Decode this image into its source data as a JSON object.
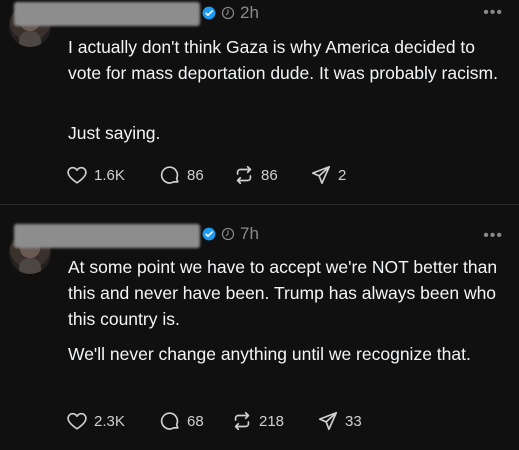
{
  "posts": [
    {
      "time": "2h",
      "paragraphs": [
        "I actually don't think Gaza is why America decided to vote for mass deportation dude. It was probably racism.",
        "Just saying."
      ],
      "likes": "1.6K",
      "replies": "86",
      "reposts": "86",
      "shares": "2",
      "more_label": "•••"
    },
    {
      "time": "7h",
      "paragraphs": [
        "At some point we have to accept we're NOT better than this and never have been. Trump has always been who this country is.",
        "We'll never change anything until we recognize that."
      ],
      "likes": "2.3K",
      "replies": "68",
      "reposts": "218",
      "shares": "33",
      "more_label": "•••"
    }
  ],
  "colors": {
    "background": "#101010",
    "text": "#f3f5f7",
    "muted": "#8a8a8a",
    "verified": "#1d9bf0"
  },
  "icons": [
    "heart-icon",
    "comment-icon",
    "repost-icon",
    "share-icon",
    "verified-icon",
    "timer-icon",
    "more-icon"
  ]
}
